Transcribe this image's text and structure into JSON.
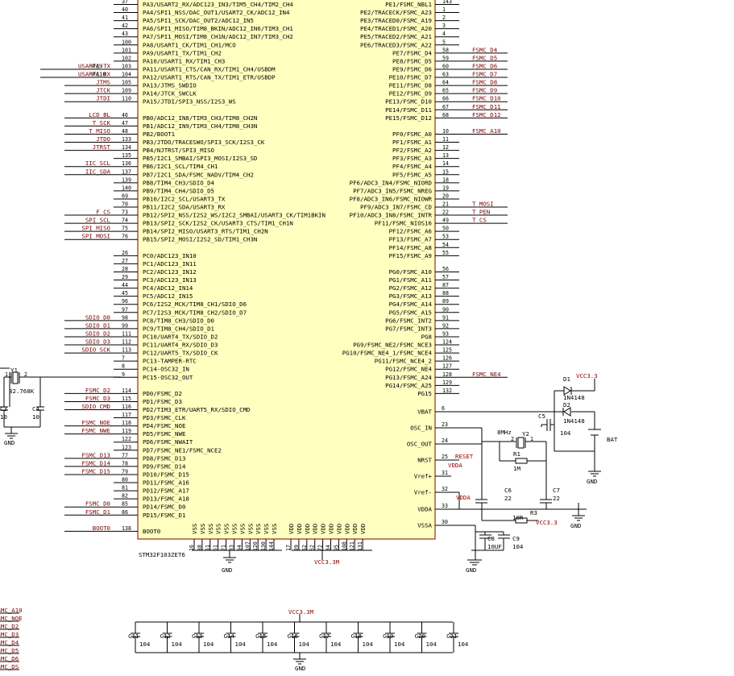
{
  "ic": {
    "designator": "STM32F103ZET6",
    "left_pins": [
      [
        "37",
        "PA3/USART2_RX/ADC123_IN3/TIM5_CH4/TIM2_CH4"
      ],
      [
        "40",
        "PA4/SPI1_NSS/DAC_OUT1/USART2_CK/ADC12_IN4"
      ],
      [
        "41",
        "PA5/SPI1_SCK/DAC_OUT2/ADC12_IN5"
      ],
      [
        "42",
        "PA6/SPI1_MISO/TIM8_BKIN/ADC12_IN6/TIM3_CH1"
      ],
      [
        "43",
        "PA7/SPI1_MOSI/TIM8_CH1N/ADC12_IN7/TIM3_CH2"
      ],
      [
        "100",
        "PA8/USART1_CK/TIM1_CH1/MCO"
      ],
      [
        "101",
        "PA9/USART1_TX/TIM1_CH2"
      ],
      [
        "102",
        "PA10/USART1_RX/TIM1_CH3"
      ],
      [
        "103",
        "PA11/USART1_CTS/CAN_RX/TIM1_CH4/USBDM"
      ],
      [
        "104",
        "PA12/USART1_RTS/CAN_TX/TIM1_ETR/USBDP"
      ],
      [
        "105",
        "PA13/JTMS_SWDIO"
      ],
      [
        "109",
        "PA14/JTCK_SWCLK"
      ],
      [
        "110",
        "PA15/JTDI/SPI3_NSS/I2S3_WS"
      ],
      [
        "",
        ""
      ],
      [
        "46",
        "PB0/ADC12_IN8/TIM3_CH3/TIM8_CH2N"
      ],
      [
        "47",
        "PB1/ADC12_IN9/TIM3_CH4/TIM8_CH3N"
      ],
      [
        "48",
        "PB2/BOOT1"
      ],
      [
        "133",
        "PB3/JTDO/TRACESWO/SPI3_SCK/I2S3_CK"
      ],
      [
        "134",
        "PB4/NJTRST/SPI3_MISO"
      ],
      [
        "135",
        "PB5/I2C1_SMBAI/SPI3_MOSI/I2S3_SD"
      ],
      [
        "136",
        "PB6/I2C1_SCL/TIM4_CH1"
      ],
      [
        "137",
        "PB7/I2C1_SDA/FSMC_NADV/TIM4_CH2"
      ],
      [
        "139",
        "PB8/TIM4_CH3/SDIO_D4"
      ],
      [
        "140",
        "PB9/TIM4_CH4/SDIO_D5"
      ],
      [
        "69",
        "PB10/I2C2_SCL/USART3_TX"
      ],
      [
        "70",
        "PB11/I2C2_SDA/USART3_RX"
      ],
      [
        "73",
        "PB12/SPI2_NSS/I2S2_WS/I2C2_SMBAI/USART3_CK/TIM1BKIN"
      ],
      [
        "74",
        "PB13/SPI2_SCK/I2S2_CK/USART3_CTS/TIM1_CH1N"
      ],
      [
        "75",
        "PB14/SPI2_MISO/USART3_RTS/TIM1_CH2N"
      ],
      [
        "76",
        "PB15/SPI2_MOSI/I2S2_SD/TIM1_CH3N"
      ],
      [
        "",
        ""
      ],
      [
        "26",
        "PC0/ADC123_IN10"
      ],
      [
        "27",
        "PC1/ADC123_IN11"
      ],
      [
        "28",
        "PC2/ADC123_IN12"
      ],
      [
        "29",
        "PC3/ADC123_IN13"
      ],
      [
        "44",
        "PC4/ADC12_IN14"
      ],
      [
        "45",
        "PC5/ADC12_IN15"
      ],
      [
        "96",
        "PC6/I2S2_MCK/TIM8_CH1/SDIO_D6"
      ],
      [
        "97",
        "PC7/I2S3_MCK/TIM8_CH2/SDIO_D7"
      ],
      [
        "98",
        "PC8/TIM8_CH3/SDIO_D0"
      ],
      [
        "99",
        "PC9/TIM8_CH4/SDIO_D1"
      ],
      [
        "111",
        "PC10/UART4_TX/SDIO_D2"
      ],
      [
        "112",
        "PC11/UART4_RX/SDIO_D3"
      ],
      [
        "113",
        "PC12/UART5_TX/SDIO_CK"
      ],
      [
        "7",
        "PC13-TAMPER-RTC"
      ],
      [
        "8",
        "PC14-OSC32_IN"
      ],
      [
        "9",
        "PC15-OSC32_OUT"
      ],
      [
        "",
        ""
      ],
      [
        "114",
        "PD0/FSMC_D2"
      ],
      [
        "115",
        "PD1/FSMC_D3"
      ],
      [
        "116",
        "PD2/TIM3_ETR/UART5_RX/SDIO_CMD"
      ],
      [
        "117",
        "PD3/FSMC_CLK"
      ],
      [
        "118",
        "PD4/FSMC_NOE"
      ],
      [
        "119",
        "PD5/FSMC_NWE"
      ],
      [
        "122",
        "PD6/FSMC_NWAIT"
      ],
      [
        "123",
        "PD7/FSMC_NE1/FSMC_NCE2"
      ],
      [
        "77",
        "PD8/FSMC_D13"
      ],
      [
        "78",
        "PD9/FSMC_D14"
      ],
      [
        "79",
        "PD10/FSMC_D15"
      ],
      [
        "80",
        "PD11/FSMC_A16"
      ],
      [
        "81",
        "PD12/FSMC_A17"
      ],
      [
        "82",
        "PD13/FSMC_A18"
      ],
      [
        "85",
        "PD14/FSMC_D0"
      ],
      [
        "86",
        "PD15/FSMC_D1"
      ],
      [
        "",
        ""
      ],
      [
        "138",
        "BOOT0"
      ]
    ],
    "right_pins": [
      [
        "143",
        "PE1/FSMC_NBL1"
      ],
      [
        "1",
        "PE2/TRACECK/FSMC_A23"
      ],
      [
        "2",
        "PE3/TRACED0/FSMC_A19"
      ],
      [
        "3",
        "PE4/TRACED1/FSMC_A20"
      ],
      [
        "4",
        "PE5/TRACED2/FSMC_A21"
      ],
      [
        "5",
        "PE6/TRACED3/FSMC_A22"
      ],
      [
        "58",
        "PE7/FSMC_D4"
      ],
      [
        "59",
        "PE8/FSMC_D5"
      ],
      [
        "60",
        "PE9/FSMC_D6"
      ],
      [
        "63",
        "PE10/FSMC_D7"
      ],
      [
        "64",
        "PE11/FSMC_D8"
      ],
      [
        "65",
        "PE12/FSMC_D9"
      ],
      [
        "66",
        "PE13/FSMC_D10"
      ],
      [
        "67",
        "PE14/FSMC_D11"
      ],
      [
        "68",
        "PE15/FSMC_D12"
      ],
      [
        "",
        ""
      ],
      [
        "10",
        "PF0/FSMC_A0"
      ],
      [
        "11",
        "PF1/FSMC_A1"
      ],
      [
        "12",
        "PF2/FSMC_A2"
      ],
      [
        "13",
        "PF3/FSMC_A3"
      ],
      [
        "14",
        "PF4/FSMC_A4"
      ],
      [
        "15",
        "PF5/FSMC_A5"
      ],
      [
        "18",
        "PF6/ADC3_IN4/FSMC_NIORD"
      ],
      [
        "19",
        "PF7/ADC3_IN5/FSMC_NREG"
      ],
      [
        "20",
        "PF8/ADC3_IN6/FSMC_NIOWR"
      ],
      [
        "21",
        "PF9/ADC3_IN7/FSMC_CD"
      ],
      [
        "22",
        "PF10/ADC3_IN8/FSMC_INTR"
      ],
      [
        "49",
        "PF11/FSMC_NIOS16"
      ],
      [
        "50",
        "PF12/FSMC_A6"
      ],
      [
        "53",
        "PF13/FSMC_A7"
      ],
      [
        "54",
        "PF14/FSMC_A8"
      ],
      [
        "55",
        "PF15/FSMC_A9"
      ],
      [
        "",
        ""
      ],
      [
        "56",
        "PG0/FSMC_A10"
      ],
      [
        "57",
        "PG1/FSMC_A11"
      ],
      [
        "87",
        "PG2/FSMC_A12"
      ],
      [
        "88",
        "PG3/FSMC_A13"
      ],
      [
        "89",
        "PG4/FSMC_A14"
      ],
      [
        "90",
        "PG5/FSMC_A15"
      ],
      [
        "91",
        "PG6/FSMC_INT2"
      ],
      [
        "92",
        "PG7/FSMC_INT3"
      ],
      [
        "93",
        "PG8"
      ],
      [
        "124",
        "PG9/FSMC_NE2/FSMC_NCE3"
      ],
      [
        "125",
        "PG10/FSMC_NE4_1/FSMC_NCE4"
      ],
      [
        "126",
        "PG11/FSMC_NCE4_2"
      ],
      [
        "127",
        "PG12/FSMC_NE4"
      ],
      [
        "128",
        "PG13/FSMC_A24"
      ],
      [
        "129",
        "PG14/FSMC_A25"
      ],
      [
        "132",
        "PG15"
      ]
    ],
    "right_power_pins": [
      [
        "6",
        "VBAT"
      ],
      [
        "23",
        "OSC_IN"
      ],
      [
        "24",
        "OSC_OUT"
      ],
      [
        "25",
        "NRST"
      ],
      [
        "31",
        "Vref+"
      ],
      [
        "32",
        "Vref-"
      ],
      [
        "33",
        "VDDA"
      ],
      [
        "30",
        "VSSA"
      ]
    ],
    "bottom_pins": [
      [
        "16",
        "VSS"
      ],
      [
        "38",
        "VSS"
      ],
      [
        "51",
        "VSS"
      ],
      [
        "61",
        "VSS"
      ],
      [
        "71",
        "VSS"
      ],
      [
        "83",
        "VSS"
      ],
      [
        "94",
        "VSS"
      ],
      [
        "107",
        "VSS"
      ],
      [
        "120",
        "VSS"
      ],
      [
        "130",
        "VSS"
      ],
      [
        "144",
        "VSS"
      ],
      [
        "17",
        "VDD"
      ],
      [
        "39",
        "VDD"
      ],
      [
        "52",
        "VDD"
      ],
      [
        "62",
        "VDD"
      ],
      [
        "72",
        "VDD"
      ],
      [
        "84",
        "VDD"
      ],
      [
        "95",
        "VDD"
      ],
      [
        "108",
        "VDD"
      ],
      [
        "121",
        "VDD"
      ],
      [
        "131",
        "VDD"
      ]
    ],
    "bottom_net": "VCC3.3M"
  },
  "left_nets": [
    [
      8,
      "USART1_TX"
    ],
    [
      9,
      "USART1_RX"
    ],
    [
      10,
      "JTMS"
    ],
    [
      11,
      "JTCK"
    ],
    [
      12,
      "JTDI"
    ],
    [
      14,
      "LCD_BL"
    ],
    [
      15,
      "T_SCK"
    ],
    [
      16,
      "T_MISO"
    ],
    [
      17,
      "JTDO"
    ],
    [
      18,
      "JTRST"
    ],
    [
      20,
      "IIC_SCL"
    ],
    [
      21,
      "IIC_SDA"
    ],
    [
      26,
      "F_CS"
    ],
    [
      27,
      "SPI_SCL"
    ],
    [
      28,
      "SPI_MISO"
    ],
    [
      29,
      "SPI_MOSI"
    ],
    [
      39,
      "SDIO_D0"
    ],
    [
      40,
      "SDIO_D1"
    ],
    [
      41,
      "SDIO_D2"
    ],
    [
      42,
      "SDIO_D3"
    ],
    [
      43,
      "SDIO_SCK"
    ],
    [
      48,
      "FSMC_D2"
    ],
    [
      49,
      "FSMC_D3"
    ],
    [
      50,
      "SDIO_CMD"
    ],
    [
      52,
      "FSMC_NOE"
    ],
    [
      53,
      "FSMC_NWE"
    ],
    [
      56,
      "FSMC_D13"
    ],
    [
      57,
      "FSMC_D14"
    ],
    [
      58,
      "FSMC_D15"
    ],
    [
      62,
      "FSMC_D0"
    ],
    [
      63,
      "FSMC_D1"
    ],
    [
      65,
      "BOOT0"
    ]
  ],
  "left_port_labels": [
    [
      8,
      "PA9"
    ],
    [
      9,
      "PA10"
    ]
  ],
  "right_nets": [
    [
      6,
      "FSMC_D4"
    ],
    [
      7,
      "FSMC_D5"
    ],
    [
      8,
      "FSMC_D6"
    ],
    [
      9,
      "FSMC_D7"
    ],
    [
      10,
      "FSMC_D8"
    ],
    [
      11,
      "FSMC_D9"
    ],
    [
      12,
      "FSMC_D10"
    ],
    [
      13,
      "FSMC_D11"
    ],
    [
      14,
      "FSMC_D12"
    ],
    [
      16,
      "FSMC_A10"
    ],
    [
      25,
      "T_MOSI"
    ],
    [
      26,
      "T_PEN"
    ],
    [
      27,
      "T_CS"
    ],
    [
      46,
      "FSMC_NE4"
    ]
  ],
  "components": {
    "y1": "Y1",
    "y1_value": "32.768K",
    "y1_pin1": "1",
    "y1_pin2": "2",
    "c3": "C3",
    "c3_value": "10",
    "c4": "C4",
    "c4_value": "10",
    "gnd": "GND",
    "y2": "Y2",
    "y2_value": "8MHz",
    "y2_pin1": "1",
    "y2_pin2": "2",
    "r1": "R1",
    "r1_value": "1M",
    "c5": "C5",
    "c5_value": "104",
    "c6": "C6",
    "c6_value": "22",
    "c7": "C7",
    "c7_value": "22",
    "d1": "D1",
    "d1_value": "1N4148",
    "d2": "D2",
    "d2_value": "1N4148",
    "bat": "BAT",
    "vcc33": "VCC3.3",
    "reset": "RESET",
    "vdda": "VDDA",
    "r3": "R3",
    "r3_value": "10R",
    "c8": "C8",
    "c8_value": "10UF",
    "c9": "C9",
    "c9_value": "104",
    "decoupling_net": "VCC3.3M",
    "decoupling": [
      [
        "C11",
        "104"
      ],
      [
        "C12",
        "104"
      ],
      [
        "C13",
        "104"
      ],
      [
        "C14",
        "104"
      ],
      [
        "C15",
        "104"
      ],
      [
        "C16",
        "104"
      ],
      [
        "C17",
        "104"
      ],
      [
        "C18",
        "104"
      ],
      [
        "C19",
        "104"
      ],
      [
        "C20",
        "104"
      ],
      [
        "C21",
        "104"
      ]
    ]
  },
  "bottom_left_nets": [
    "FSMC_A10",
    "FSMC_NOE",
    "FSMC_D2",
    "FSMC_D3",
    "FSMC_D4",
    "FSMC_D5",
    "FSMC_D6",
    "FSMC_DS"
  ]
}
